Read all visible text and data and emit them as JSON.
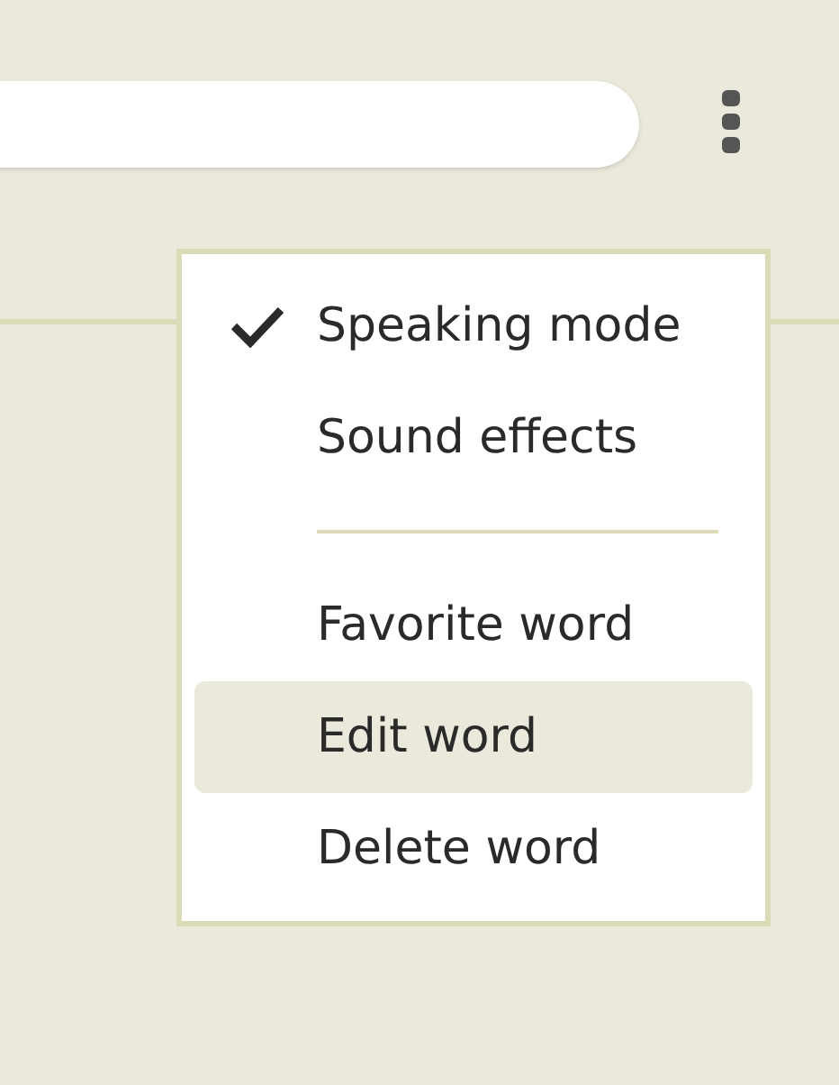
{
  "menu": {
    "items": [
      {
        "kind": "option",
        "label": "Speaking mode",
        "checked": true
      },
      {
        "kind": "option",
        "label": "Sound effects",
        "checked": false
      },
      {
        "kind": "separator"
      },
      {
        "kind": "action",
        "label": "Favorite word",
        "selected": false
      },
      {
        "kind": "action",
        "label": "Edit word",
        "selected": true
      },
      {
        "kind": "action",
        "label": "Delete word",
        "selected": false
      }
    ]
  }
}
